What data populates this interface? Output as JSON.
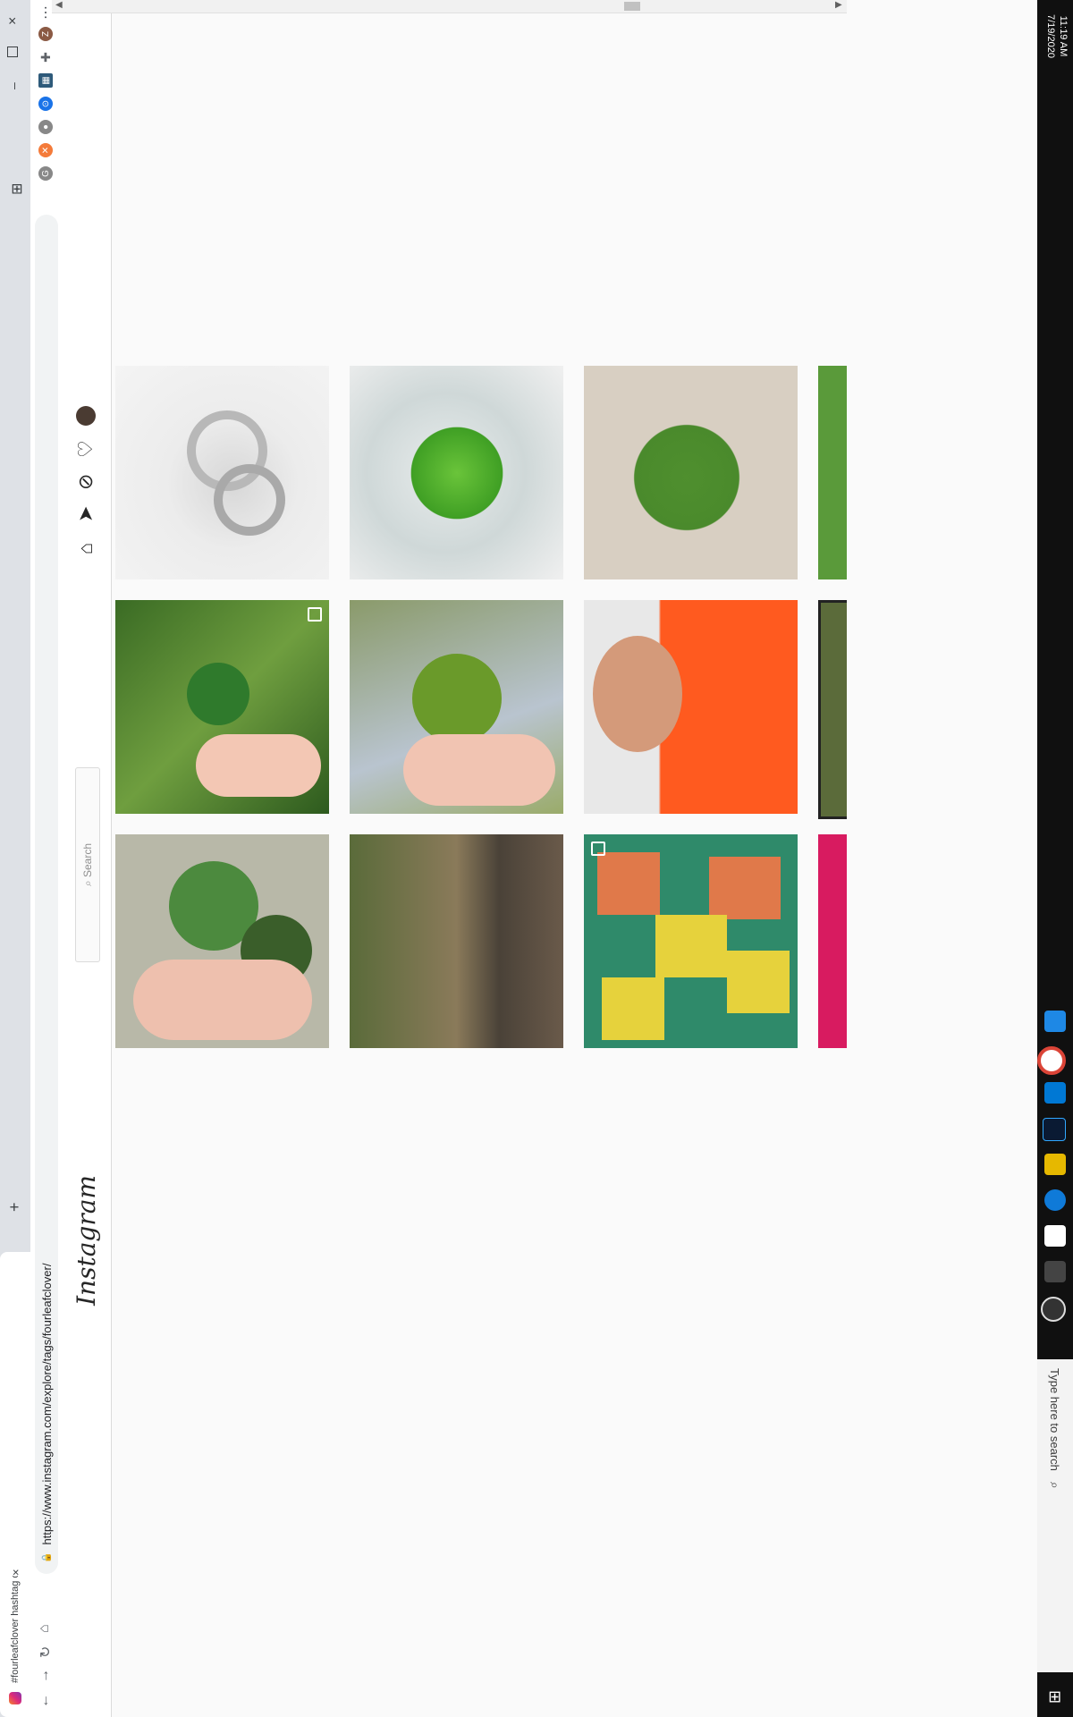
{
  "browser": {
    "tab_title": "#fourleafclover hashtag on Insta",
    "tab_close": "×",
    "new_tab": "+",
    "url": "https://www.instagram.com/explore/tags/fourleafclover/",
    "lock_icon": "🔒",
    "minimize": "–",
    "close": "×",
    "menu": "⋯",
    "tile": "⊞"
  },
  "nav_buttons": {
    "back": "←",
    "forward": "→",
    "reload": "↻",
    "home": "⌂"
  },
  "instagram": {
    "logo": "Instagram",
    "search_placeholder": "⌕ Search",
    "icons": {
      "home": "⌂",
      "direct": "➤",
      "explore": "⊘",
      "activity": "♡"
    }
  },
  "taskbar": {
    "search_text": "Type here to search",
    "time": "11:19 AM",
    "date": "7/19/2020",
    "windows_icon": "⊞",
    "search_icon": "⌕"
  },
  "grid": {
    "row1": [
      "ring-photo",
      "clover-in-glass-photo",
      "clover-on-sand-photo"
    ],
    "row2": [
      "clover-in-hand-grass-photo",
      "clover-held-fingers-photo",
      "child-with-clover-photo"
    ],
    "row3": [
      "two-clovers-hand-photo",
      "forest-path-photo",
      "butterfly-earrings-photo"
    ]
  },
  "colors": {
    "accent": "#e1306c",
    "taskbar": "#101010",
    "page_bg": "#fafafa"
  }
}
